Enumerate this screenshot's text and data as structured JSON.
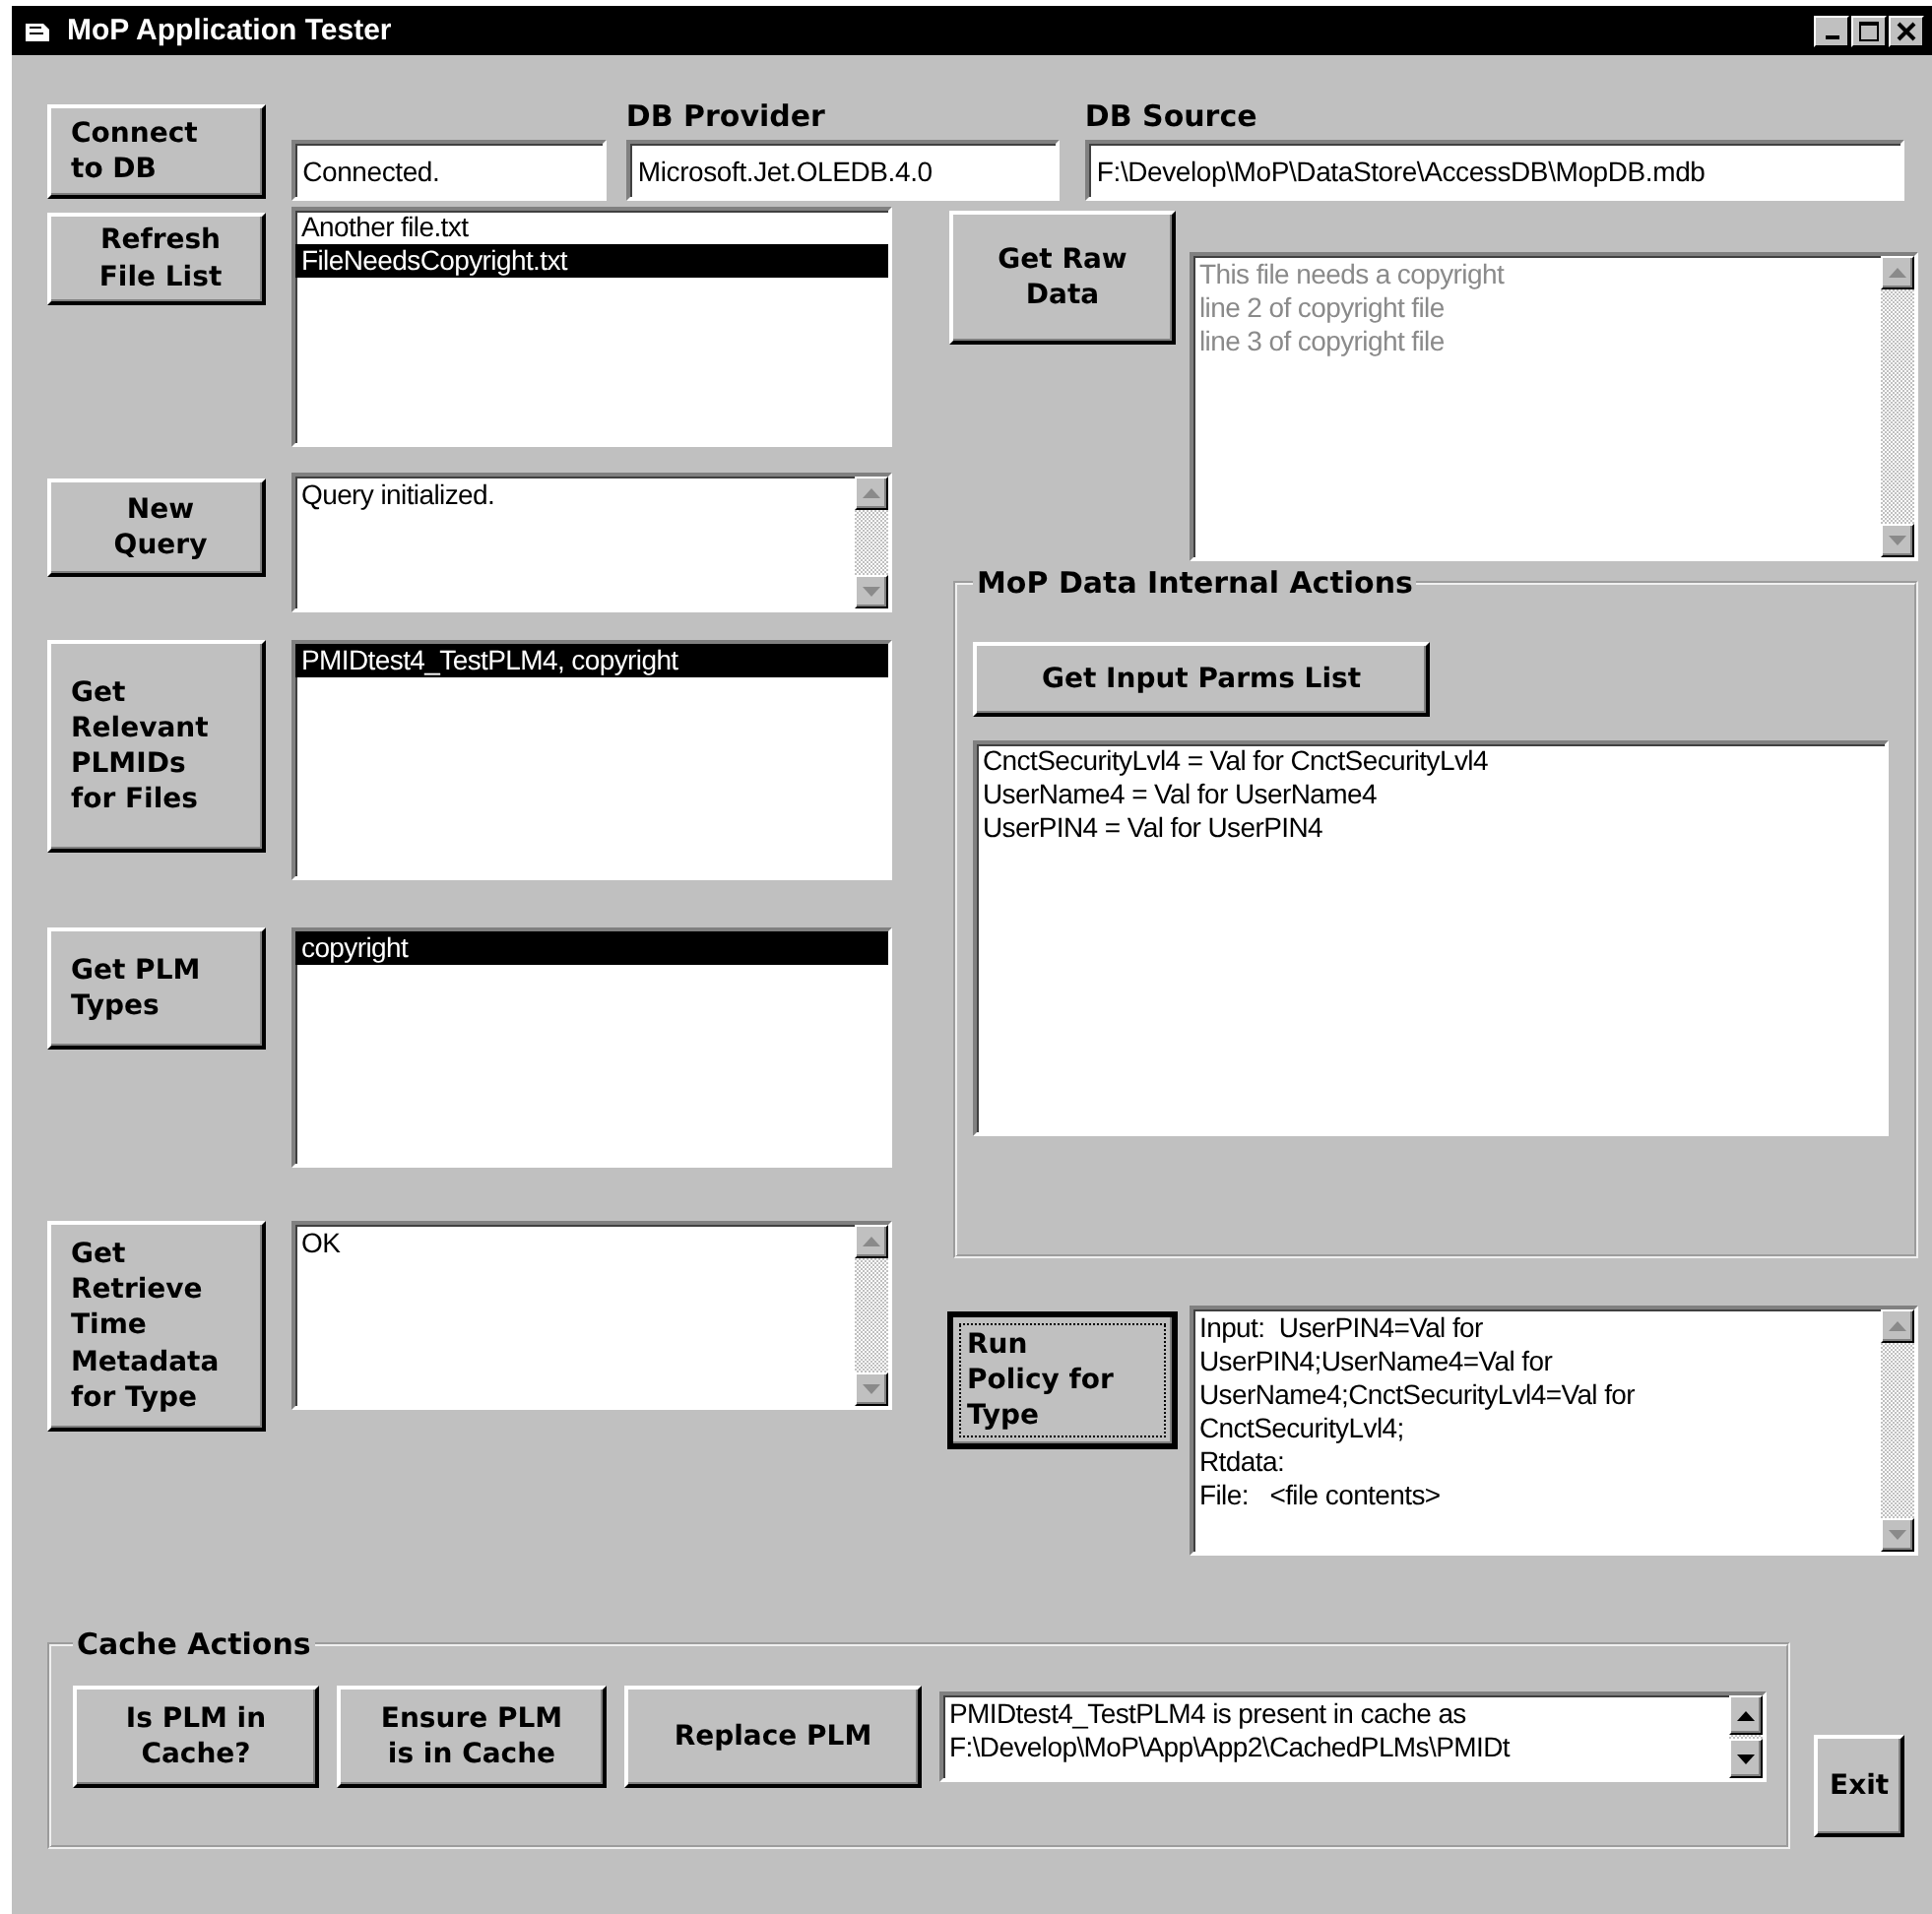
{
  "window": {
    "title": "MoP Application Tester"
  },
  "connection": {
    "button": "Connect\nto DB",
    "status": "Connected.",
    "provider_label": "DB Provider",
    "provider": "Microsoft.Jet.OLEDB.4.0",
    "source_label": "DB Source",
    "source": "F:\\Develop\\MoP\\DataStore\\AccessDB\\MopDB.mdb"
  },
  "left_rows": [
    {
      "button": "Refresh\nFile List",
      "kind": "list",
      "items": [
        {
          "label": "Another file.txt",
          "selected": false
        },
        {
          "label": "FileNeedsCopyright.txt",
          "selected": true
        }
      ]
    },
    {
      "button": "New\nQuery",
      "kind": "text",
      "lines": [
        "Query initialized."
      ]
    },
    {
      "button": "Get\nRelevant\nPLMIDs\nfor Files",
      "kind": "list",
      "items": [
        {
          "label": "PMIDtest4_TestPLM4, copyright",
          "selected": true
        }
      ]
    },
    {
      "button": "Get PLM\nTypes",
      "kind": "list",
      "items": [
        {
          "label": "copyright",
          "selected": true
        }
      ]
    },
    {
      "button": "Get\nRetrieve\nTime\nMetadata\nfor Type",
      "kind": "text",
      "lines": [
        "OK"
      ]
    }
  ],
  "raw_data": {
    "button": "Get Raw\nData",
    "disabled": true,
    "lines": [
      "This file needs a copyright",
      "line 2 of copyright file",
      "line 3 of copyright file"
    ]
  },
  "internal_actions": {
    "title": "MoP Data Internal Actions",
    "button": "Get Input Parms List",
    "items": [
      {
        "label": "CnctSecurityLvl4 = Val for CnctSecurityLvl4",
        "selected": false
      },
      {
        "label": "UserName4 = Val for UserName4",
        "selected": false
      },
      {
        "label": "UserPIN4 = Val for UserPIN4",
        "selected": false
      }
    ]
  },
  "run_policy": {
    "button": "Run\nPolicy for\nType",
    "focused": true,
    "lines": [
      "Input:  UserPIN4=Val for",
      "UserPIN4;UserName4=Val for",
      "UserName4;CnctSecurityLvl4=Val for",
      "CnctSecurityLvl4;",
      "Rtdata:",
      "File:   <file contents>"
    ]
  },
  "cache_actions": {
    "title": "Cache Actions",
    "buttons": [
      "Is PLM in\nCache?",
      "Ensure PLM\nis in Cache",
      "Replace PLM"
    ],
    "lines": [
      "PMIDtest4_TestPLM4 is present in cache as",
      "F:\\Develop\\MoP\\App\\App2\\CachedPLMs\\PMIDt"
    ]
  },
  "exit_button": "Exit"
}
